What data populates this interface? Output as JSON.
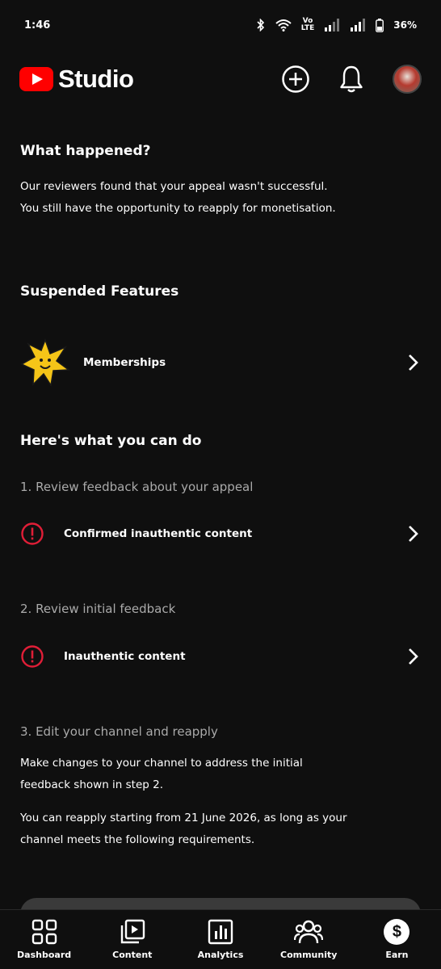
{
  "status_bar": {
    "time": "1:46",
    "network_top": "Vo",
    "network_bottom": "LTE",
    "battery": "36%"
  },
  "header": {
    "app_name": "Studio",
    "icons": [
      "create-icon",
      "notifications-icon",
      "avatar"
    ]
  },
  "what_happened": {
    "title": "What happened?",
    "line1": "Our reviewers found that your appeal wasn't successful.",
    "line2": "You still have the opportunity to reapply for monetisation."
  },
  "suspended": {
    "title": "Suspended Features",
    "items": [
      {
        "label": "Memberships",
        "icon": "memberships-star-icon"
      }
    ]
  },
  "what_you_can_do": {
    "title": "Here's what you can do",
    "step1": {
      "title": "1. Review feedback about your appeal",
      "item_label": "Confirmed inauthentic content"
    },
    "step2": {
      "title": "2. Review initial feedback",
      "item_label": "Inauthentic content"
    },
    "step3": {
      "title": "3. Edit your channel and reapply",
      "line1": "Make changes to your channel to address the initial",
      "line2": "feedback shown in step  2.",
      "line3": "You can reapply starting from 21 June 2026, as long as your",
      "line4": "channel meets the following requirements."
    }
  },
  "bottom_nav": {
    "items": [
      {
        "label": "Dashboard",
        "icon": "dashboard-icon"
      },
      {
        "label": "Content",
        "icon": "content-icon"
      },
      {
        "label": "Analytics",
        "icon": "analytics-icon"
      },
      {
        "label": "Community",
        "icon": "community-icon"
      },
      {
        "label": "Earn",
        "icon": "earn-icon"
      }
    ]
  },
  "colors": {
    "background": "#0f0f0f",
    "brand_red": "#ff0000",
    "alert_red": "#e01e37",
    "muted_text": "#aaaaaa",
    "star_yellow": "#f5c518"
  }
}
